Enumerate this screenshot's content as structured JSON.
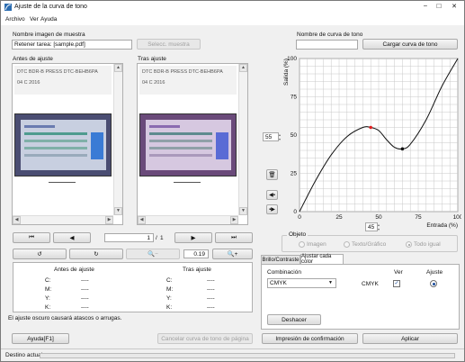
{
  "window": {
    "title": "Ajuste de la curva de tono",
    "controls": {
      "minimize": "–",
      "maximize": "□",
      "close": "✕"
    }
  },
  "menu": [
    "Archivo",
    "Ver",
    "Ayuda"
  ],
  "left": {
    "sample_name_label": "Nombre imagen de muestra",
    "sample_name_value": "Retener tarea: [sample.pdf]",
    "select_sample_button": "Selecc. muestra",
    "before_label": "Antes de ajuste",
    "after_label": "Tras ajuste",
    "preview_text_line1": "DTC BDR-B PRESS DTC-BEHB6PA",
    "preview_text_line2": "04 C 2016",
    "page_current": "1",
    "page_sep": "/",
    "page_total": "1",
    "zoom_value": "0.19",
    "table": {
      "before_header": "Antes de ajuste",
      "after_header": "Tras ajuste",
      "rows": [
        {
          "ch": "C:",
          "before": "----",
          "after_ch": "C:",
          "after": "----"
        },
        {
          "ch": "M:",
          "before": "----",
          "after_ch": "M:",
          "after": "----"
        },
        {
          "ch": "Y:",
          "before": "----",
          "after_ch": "Y:",
          "after": "----"
        },
        {
          "ch": "K:",
          "before": "----",
          "after_ch": "K:",
          "after": "----"
        }
      ]
    },
    "warning": "El ajuste oscuro causará atascos o arrugas."
  },
  "right": {
    "curve_name_label": "Nombre de curva de tono",
    "curve_name_value": "",
    "load_curve_button": "Cargar curva de tono",
    "chart": {
      "ylabel": "Salida (%)",
      "xlabel": "Entrada (%)",
      "xticks": [
        "0",
        "25",
        "50",
        "75",
        "100"
      ],
      "yticks": [
        "0",
        "25",
        "50",
        "75",
        "100"
      ],
      "output_value": "55",
      "input_value": "45"
    },
    "object_group": {
      "label": "Objeto",
      "options": [
        "Imagen",
        "Texto/Gráfico",
        "Todo igual"
      ],
      "selected": "Todo igual"
    },
    "tabs": [
      "Brillo/Contraste",
      "Ajustar cada color"
    ],
    "active_tab": "Ajustar cada color",
    "combination": {
      "label": "Combinación",
      "value": "CMYK",
      "ver_header": "Ver",
      "adjust_header": "Ajuste",
      "row_label": "CMYK"
    },
    "undo_button": "Deshacer"
  },
  "footer": {
    "help_button": "Ayuda[F1]",
    "cancel_curve_button": "Cancelar curva de tono de página",
    "print_confirm_button": "Impresión de confirmación",
    "apply_button": "Aplicar"
  },
  "status": {
    "label": "Destino actual"
  },
  "chart_data": {
    "type": "line",
    "title": "",
    "xlabel": "Entrada (%)",
    "ylabel": "Salida (%)",
    "xlim": [
      0,
      100
    ],
    "ylim": [
      0,
      100
    ],
    "grid": true,
    "series": [
      {
        "x": [
          0,
          10,
          20,
          30,
          40,
          45,
          50,
          55,
          60,
          65,
          70,
          80,
          90,
          100
        ],
        "y": [
          0,
          20,
          37,
          49,
          55,
          55,
          53,
          47,
          42,
          41,
          44,
          60,
          82,
          100
        ]
      }
    ],
    "control_points": [
      {
        "x": 45,
        "y": 55,
        "color": "#e02020"
      },
      {
        "x": 65,
        "y": 41,
        "color": "#111111"
      }
    ]
  }
}
